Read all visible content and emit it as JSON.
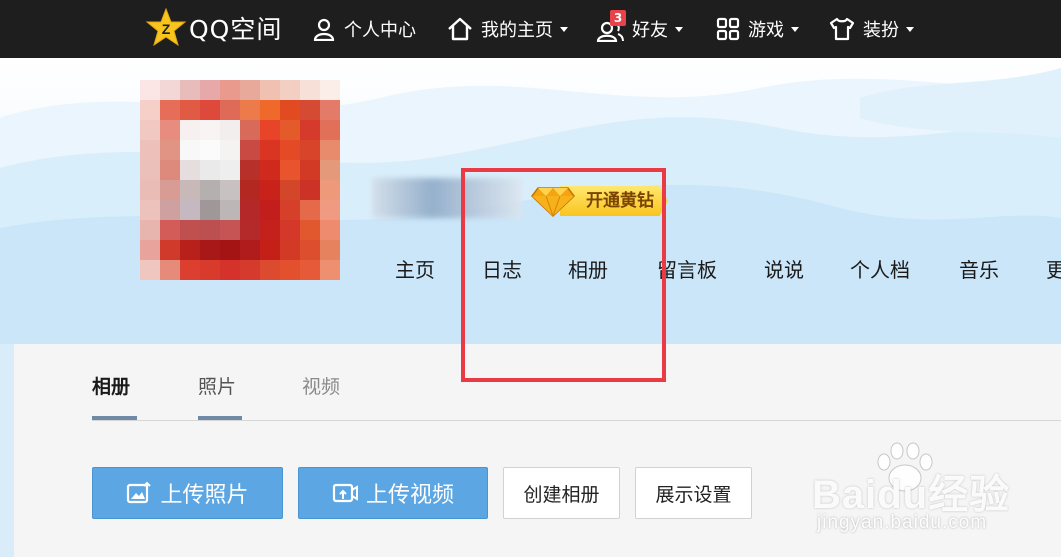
{
  "topbar": {
    "logo_text": "QQ空间",
    "items": [
      {
        "label": "个人中心",
        "icon": "person-icon"
      },
      {
        "label": "我的主页",
        "icon": "home-icon"
      },
      {
        "label": "好友",
        "icon": "friends-icon",
        "badge": "3"
      },
      {
        "label": "游戏",
        "icon": "grid-icon"
      },
      {
        "label": "装扮",
        "icon": "shirt-icon"
      }
    ]
  },
  "profile": {
    "vip_button": "开通黄钻"
  },
  "profile_tabs": [
    "主页",
    "日志",
    "相册",
    "留言板",
    "说说",
    "个人档",
    "音乐",
    "更"
  ],
  "album_tabs": [
    "相册",
    "照片",
    "视频"
  ],
  "actions": {
    "upload_photo": "上传照片",
    "upload_video": "上传视频",
    "create_album": "创建相册",
    "display_settings": "展示设置"
  },
  "watermark": {
    "main": "Baidu经验",
    "sub": "jingyan.baidu.com"
  },
  "colors": {
    "topbar_bg": "#1e1e1e",
    "accent_blue": "#5ba6e3",
    "highlight_red": "#ea3a44",
    "vip_gold": "#f9c41e"
  }
}
